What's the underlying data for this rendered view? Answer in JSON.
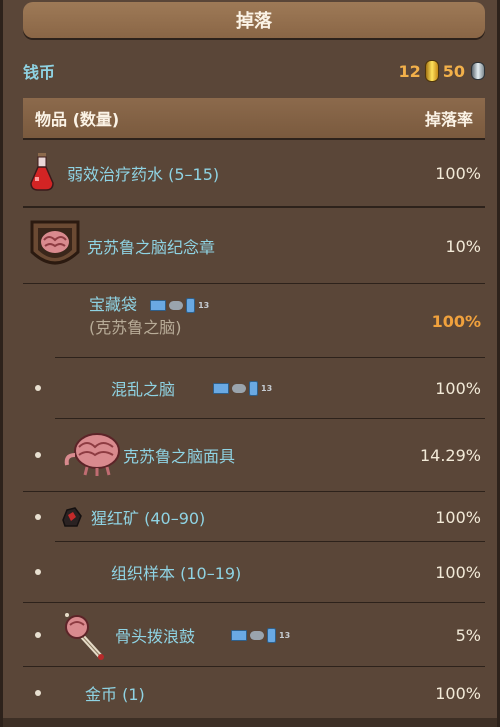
{
  "header": {
    "title": "掉落"
  },
  "coins": {
    "label": "钱币",
    "gold": "12",
    "silver": "50",
    "gold_icon": "gold-coin-icon",
    "silver_icon": "silver-coin-icon"
  },
  "table": {
    "col_item": "物品 (数量)",
    "col_rate": "掉落率"
  },
  "rows": [
    {
      "name": "弱效治疗药水 (5–15)",
      "rate": "100%",
      "icon": "healing-potion-icon"
    },
    {
      "name": "克苏鲁之脑纪念章",
      "rate": "10%",
      "icon": "brain-relic-icon"
    },
    {
      "name": "宝藏袋",
      "sub": "(克苏鲁之脑)",
      "rate": "100%",
      "platform_badge": "13"
    },
    {
      "name": "混乱之脑",
      "rate": "100%",
      "platform_badge": "13"
    },
    {
      "name": "克苏鲁之脑面具",
      "rate": "14.29%",
      "icon": "brain-mask-icon"
    },
    {
      "name": "猩红矿 (40–90)",
      "rate": "100%",
      "icon": "crimtane-ore-icon"
    },
    {
      "name": "组织样本 (10–19)",
      "rate": "100%"
    },
    {
      "name": "骨头拨浪鼓",
      "rate": "5%",
      "platform_badge": "13",
      "icon": "bone-rattle-icon"
    },
    {
      "name": "金币 (1)",
      "rate": "100%"
    }
  ],
  "colors": {
    "accent_name": "#8fd3e3",
    "highlight_rate": "#f0a13d",
    "panel": "#5a4638"
  }
}
